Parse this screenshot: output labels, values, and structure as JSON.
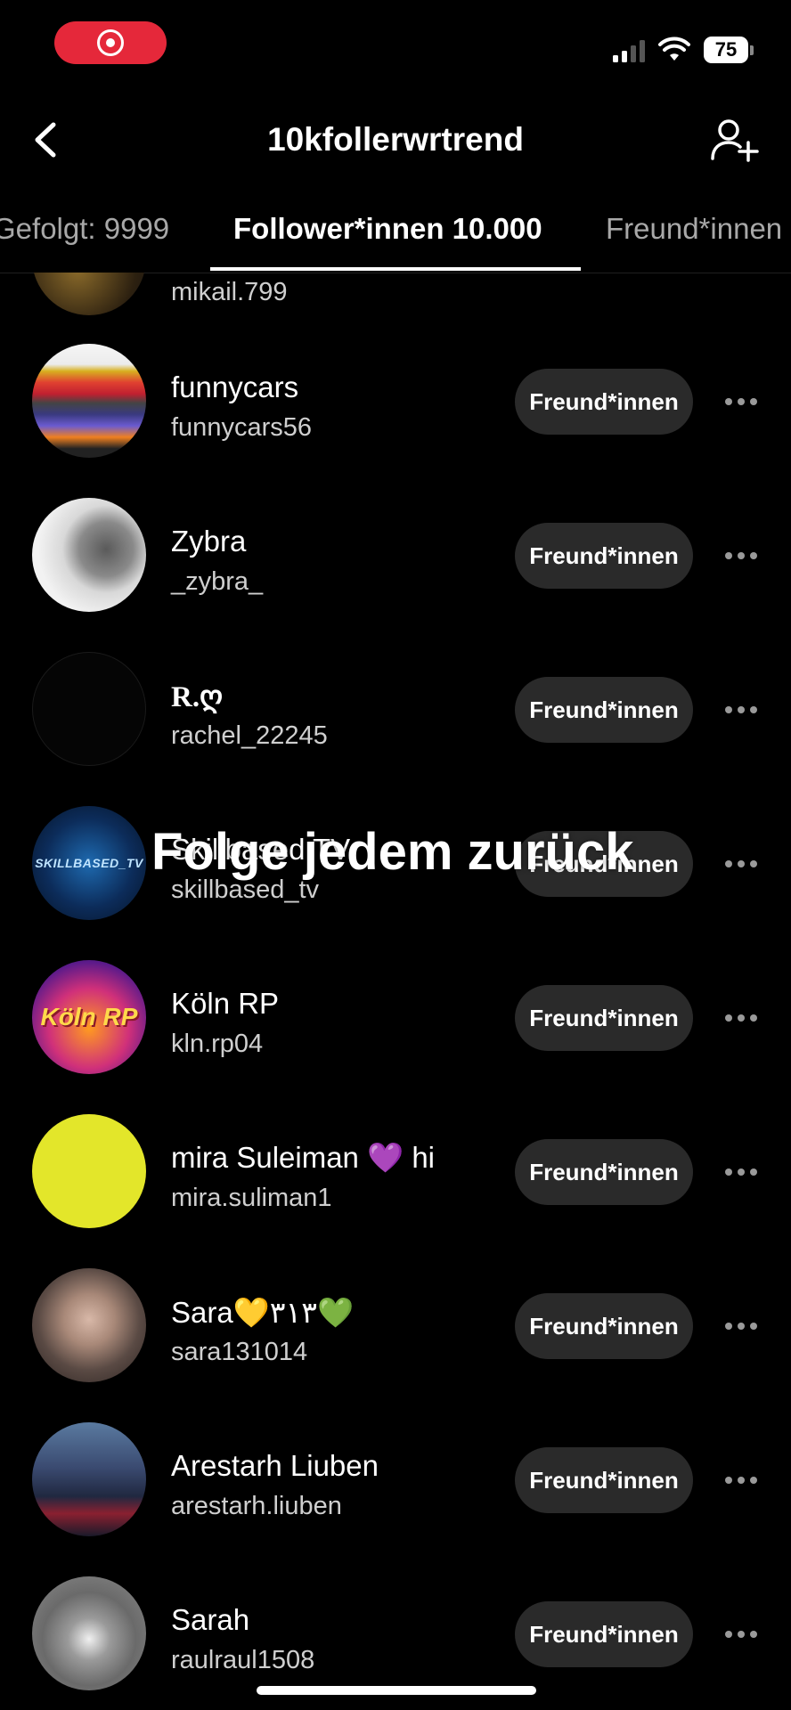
{
  "status_bar": {
    "battery": "75"
  },
  "header": {
    "title": "10kfollerwrtrend"
  },
  "tabs": [
    {
      "label": "Gefolgt: 9999"
    },
    {
      "label": "Follower*innen 10.000"
    },
    {
      "label": "Freund*innen"
    }
  ],
  "overlay_text": "Folge jedem zurück",
  "button_label": "Freund*innen",
  "rows": [
    {
      "name": "",
      "handle": "mikail.799"
    },
    {
      "name": "funnycars",
      "handle": "funnycars56"
    },
    {
      "name": "Zybra",
      "handle": "_zybra_"
    },
    {
      "name": "R.ღ",
      "handle": "rachel_22245"
    },
    {
      "name": "Skillbased TV",
      "handle": "skillbased_tv",
      "avatar_text": "SKILLBASED_TV"
    },
    {
      "name": "Köln RP",
      "handle": "kln.rp04",
      "avatar_text": "Köln RP"
    },
    {
      "name": "mira Suleiman 💜 hi",
      "handle": "mira.suliman1"
    },
    {
      "name": "Sara💛٣١٣💚",
      "handle": "sara131014"
    },
    {
      "name": "Arestarh Liuben",
      "handle": "arestarh.liuben"
    },
    {
      "name": "Sarah",
      "handle": "raulraul1508"
    }
  ],
  "colors": {
    "background": "#000000",
    "button_bg": "#2a2a2a",
    "record_pill": "#e5283a"
  }
}
